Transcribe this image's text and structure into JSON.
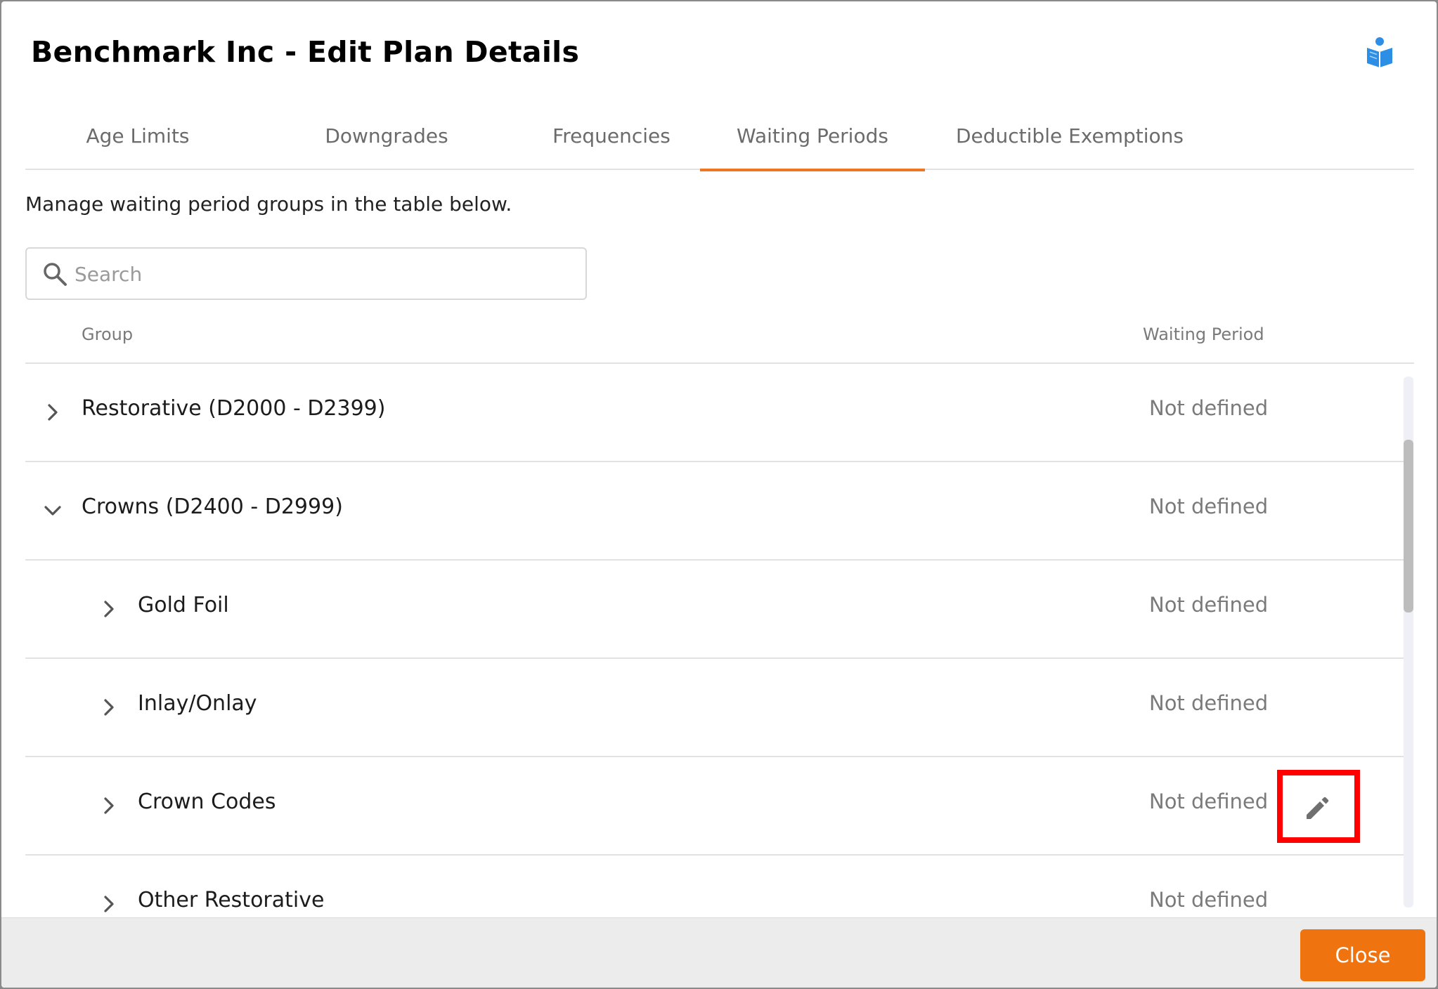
{
  "dialog": {
    "title": "Benchmark Inc - Edit Plan Details"
  },
  "tabs": [
    {
      "label": "Age Limits"
    },
    {
      "label": "Downgrades"
    },
    {
      "label": "Frequencies"
    },
    {
      "label": "Waiting Periods",
      "active": true
    },
    {
      "label": "Deductible Exemptions"
    }
  ],
  "instructions": "Manage waiting period groups in the table below.",
  "search": {
    "placeholder": "Search",
    "value": ""
  },
  "table": {
    "headers": {
      "group": "Group",
      "waiting_period": "Waiting Period"
    },
    "rows": [
      {
        "label": "Restorative (D2000 - D2399)",
        "value": "Not defined",
        "expanded": false,
        "level": 0
      },
      {
        "label": "Crowns (D2400 - D2999)",
        "value": "Not defined",
        "expanded": true,
        "level": 0
      },
      {
        "label": "Gold Foil",
        "value": "Not defined",
        "expanded": false,
        "level": 1
      },
      {
        "label": "Inlay/Onlay",
        "value": "Not defined",
        "expanded": false,
        "level": 1
      },
      {
        "label": "Crown Codes",
        "value": "Not defined",
        "expanded": false,
        "level": 1,
        "edit_icon": "pencil-icon"
      },
      {
        "label": "Other Restorative",
        "value": "Not defined",
        "expanded": false,
        "level": 1
      }
    ]
  },
  "footer": {
    "close_label": "Close"
  },
  "colors": {
    "accent": "#ef7410",
    "tab_underline": "#ee7621",
    "help_icon": "#2d8ee6",
    "highlight": "#ff0000"
  },
  "icons": {
    "help": "book-reader-icon",
    "search": "search-icon",
    "expand": "chevron-right-icon",
    "collapse": "chevron-down-icon",
    "edit": "pencil-icon"
  }
}
